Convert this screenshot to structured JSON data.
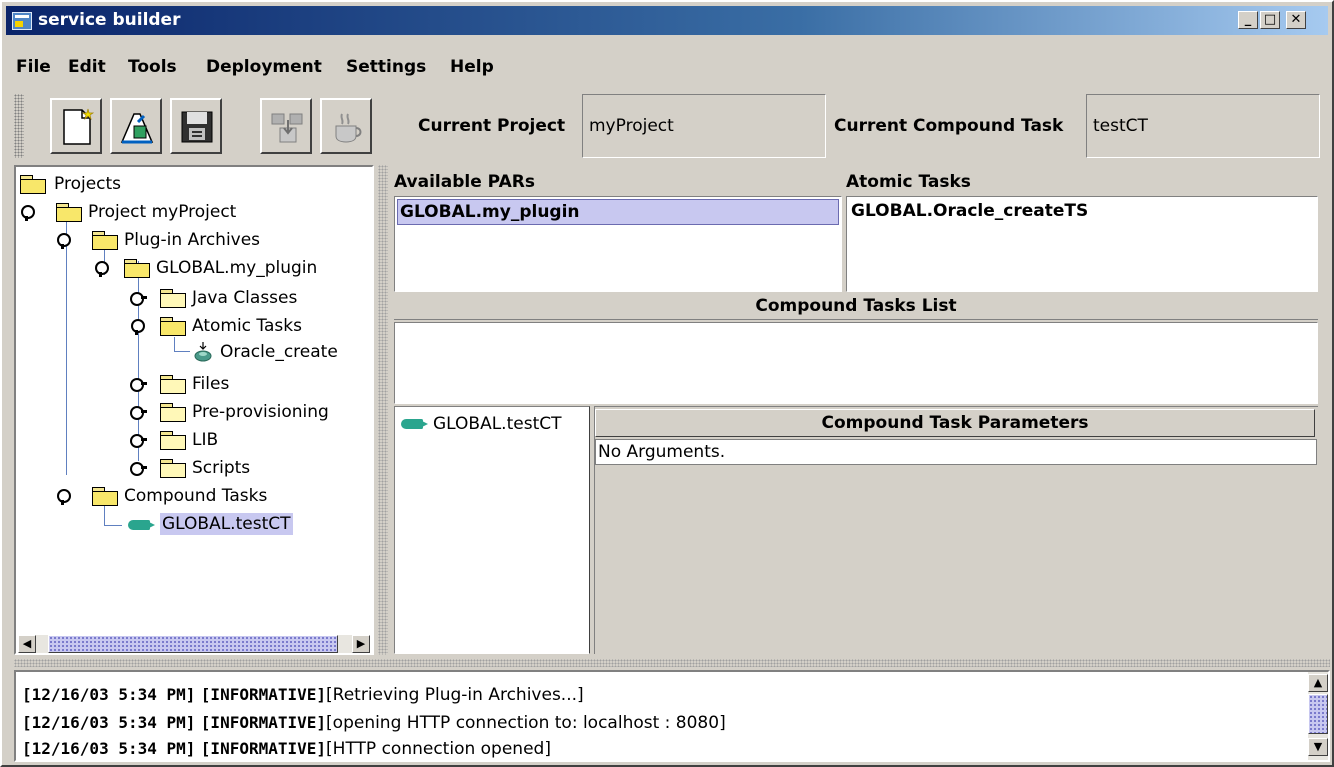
{
  "window": {
    "title": "service builder"
  },
  "menubar": [
    "File",
    "Edit",
    "Tools",
    "Deployment",
    "Settings",
    "Help"
  ],
  "toolbar": {
    "tools": [
      {
        "name": "new-file-icon"
      },
      {
        "name": "open-project-icon"
      },
      {
        "name": "save-disk-icon"
      },
      {
        "name": "deploy-icon",
        "disabled": true
      },
      {
        "name": "build-coffee-icon",
        "disabled": true
      }
    ],
    "current_project_label": "Current Project",
    "current_project_value": "myProject",
    "current_compound_task_label": "Current Compound Task",
    "current_compound_task_value": "testCT"
  },
  "tree": {
    "root": "Projects",
    "project": "Project myProject",
    "plugin_archives": "Plug-in Archives",
    "plugin": "GLOBAL.my_plugin",
    "java_classes": "Java Classes",
    "atomic_tasks": "Atomic Tasks",
    "atomic_task_item": "Oracle_create",
    "files": "Files",
    "pre_provisioning": "Pre-provisioning",
    "lib": "LIB",
    "scripts": "Scripts",
    "compound_tasks": "Compound Tasks",
    "compound_task_item": "GLOBAL.testCT"
  },
  "panels": {
    "available_pars_header": "Available PARs",
    "available_pars": [
      "GLOBAL.my_plugin"
    ],
    "atomic_tasks_header": "Atomic Tasks",
    "atomic_tasks": [
      "GLOBAL.Oracle_createTS"
    ],
    "compound_tasks_list_header": "Compound Tasks List",
    "compound_task_entry": "GLOBAL.testCT",
    "params_header": "Compound Task Parameters",
    "params_row": "No Arguments."
  },
  "log": [
    {
      "ts": "[12/16/03 5:34 PM]",
      "level": "[INFORMATIVE]",
      "msg": "[Retrieving Plug-in Archives...]"
    },
    {
      "ts": "[12/16/03 5:34 PM]",
      "level": "[INFORMATIVE]",
      "msg": "[opening HTTP connection to: localhost : 8080]"
    },
    {
      "ts": "[12/16/03 5:34 PM]",
      "level": "[INFORMATIVE]",
      "msg": "[HTTP connection opened]"
    }
  ]
}
